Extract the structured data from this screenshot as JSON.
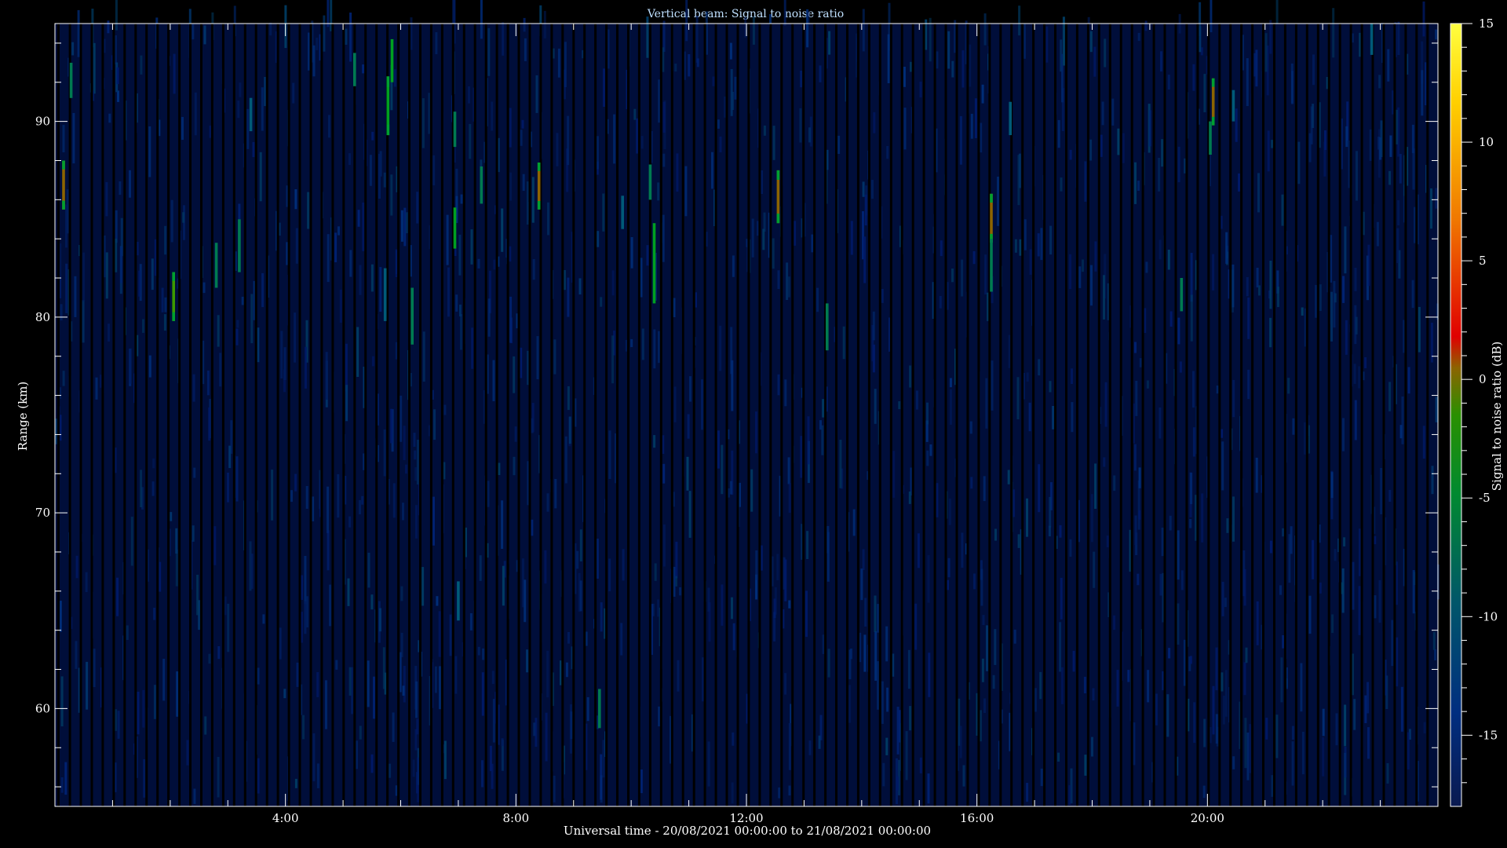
{
  "chart_data": {
    "type": "heatmap",
    "title": "Vertical beam: Signal to noise ratio",
    "xlabel": "Universal time - 20/08/2021 00:00:00 to 21/08/2021 00:00:00",
    "ylabel": "Range (km)",
    "colorbar_label": "Signal to noise ratio (dB)",
    "x_range_hours": [
      0,
      24
    ],
    "y_range_km": [
      55,
      95
    ],
    "color_range_db": [
      -18,
      15
    ],
    "x_ticks": [
      {
        "value": 4,
        "label": "4:00"
      },
      {
        "value": 8,
        "label": "8:00"
      },
      {
        "value": 12,
        "label": "12:00"
      },
      {
        "value": 16,
        "label": "16:00"
      },
      {
        "value": 20,
        "label": "20:00"
      }
    ],
    "y_ticks": [
      {
        "value": 60,
        "label": "60"
      },
      {
        "value": 70,
        "label": "70"
      },
      {
        "value": 80,
        "label": "80"
      },
      {
        "value": 90,
        "label": "90"
      }
    ],
    "cbar_ticks": [
      {
        "value": 15,
        "label": "15"
      },
      {
        "value": 10,
        "label": "10"
      },
      {
        "value": 5,
        "label": "5"
      },
      {
        "value": 0,
        "label": "0"
      },
      {
        "value": -5,
        "label": "-5"
      },
      {
        "value": -10,
        "label": "-10"
      },
      {
        "value": -15,
        "label": "-15"
      }
    ],
    "background_db": -15,
    "data_gap_hours": [
      0.06,
      0.26,
      0.45,
      0.64,
      0.83,
      1.02,
      1.21,
      1.4,
      1.59,
      1.78,
      1.97,
      2.16,
      2.35,
      2.54,
      2.73,
      2.92,
      3.11,
      3.3,
      3.49,
      3.68,
      3.87,
      4.06,
      4.25,
      4.44,
      4.63,
      4.82,
      5.01,
      5.2,
      5.39,
      5.58,
      5.77,
      5.96,
      6.15,
      6.34,
      6.53,
      6.72,
      6.91,
      7.1,
      7.29,
      7.48,
      7.67,
      7.86,
      8.05,
      8.24,
      8.43,
      8.62,
      8.81,
      9.0,
      9.19,
      9.38,
      9.57,
      9.76,
      9.95,
      10.14,
      10.33,
      10.52,
      10.71,
      10.9,
      11.09,
      11.28,
      11.47,
      11.66,
      11.85,
      12.04,
      12.23,
      12.42,
      12.61,
      12.8,
      12.99,
      13.18,
      13.37,
      13.56,
      13.75,
      13.94,
      14.13,
      14.32,
      14.51,
      14.7,
      14.89,
      15.08,
      15.27,
      15.46,
      15.65,
      15.84,
      16.03,
      16.22,
      16.41,
      16.6,
      16.79,
      16.98,
      17.17,
      17.36,
      17.55,
      17.74,
      17.93,
      18.12,
      18.31,
      18.5,
      18.69,
      18.88,
      19.07,
      19.26,
      19.45,
      19.64,
      19.83,
      20.02,
      20.21,
      20.4,
      20.59,
      20.78,
      20.97,
      21.16,
      21.35,
      21.54,
      21.73,
      21.92,
      22.11,
      22.3,
      22.49,
      22.68,
      22.87,
      23.06,
      23.25,
      23.44,
      23.63,
      23.82
    ],
    "echoes": [
      {
        "t": 0.15,
        "r0": 85.5,
        "r1": 88,
        "db": 0
      },
      {
        "t": 0.28,
        "r0": 91.2,
        "r1": 93,
        "db": -7
      },
      {
        "t": 2.06,
        "r0": 79.8,
        "r1": 82.3,
        "db": -2
      },
      {
        "t": 2.8,
        "r0": 81.5,
        "r1": 83.8,
        "db": -6
      },
      {
        "t": 3.2,
        "r0": 82.3,
        "r1": 85,
        "db": -8
      },
      {
        "t": 3.4,
        "r0": 89.5,
        "r1": 91.2,
        "db": -9
      },
      {
        "t": 5.2,
        "r0": 91.8,
        "r1": 93.5,
        "db": -8
      },
      {
        "t": 5.73,
        "r0": 79.8,
        "r1": 82.5,
        "db": -9
      },
      {
        "t": 5.78,
        "r0": 89.3,
        "r1": 92.3,
        "db": -3
      },
      {
        "t": 5.85,
        "r0": 92,
        "r1": 94.2,
        "db": -4
      },
      {
        "t": 6.2,
        "r0": 78.6,
        "r1": 81.5,
        "db": -8
      },
      {
        "t": 6.94,
        "r0": 88.7,
        "r1": 90.5,
        "db": -7
      },
      {
        "t": 6.94,
        "r0": 83.5,
        "r1": 85.6,
        "db": -5
      },
      {
        "t": 7.0,
        "r0": 64.5,
        "r1": 66.5,
        "db": -9
      },
      {
        "t": 7.4,
        "r0": 85.8,
        "r1": 87.7,
        "db": -8
      },
      {
        "t": 8.4,
        "r0": 85.5,
        "r1": 87.9,
        "db": 0
      },
      {
        "t": 9.45,
        "r0": 59,
        "r1": 61,
        "db": -7
      },
      {
        "t": 9.85,
        "r0": 84.5,
        "r1": 86.2,
        "db": -9
      },
      {
        "t": 10.33,
        "r0": 86,
        "r1": 87.8,
        "db": -6
      },
      {
        "t": 10.4,
        "r0": 80.7,
        "r1": 84.8,
        "db": -5
      },
      {
        "t": 12.55,
        "r0": 84.8,
        "r1": 87.5,
        "db": 0
      },
      {
        "t": 13.4,
        "r0": 78.3,
        "r1": 80.7,
        "db": -6
      },
      {
        "t": 16.25,
        "r0": 83.8,
        "r1": 86.3,
        "db": 0
      },
      {
        "t": 16.25,
        "r0": 81.3,
        "r1": 84,
        "db": -7
      },
      {
        "t": 16.58,
        "r0": 89.3,
        "r1": 91,
        "db": -9
      },
      {
        "t": 19.55,
        "r0": 80.3,
        "r1": 82,
        "db": -8
      },
      {
        "t": 20.1,
        "r0": 89.8,
        "r1": 92.2,
        "db": 0
      },
      {
        "t": 20.05,
        "r0": 88.3,
        "r1": 90,
        "db": -7
      },
      {
        "t": 20.45,
        "r0": 90,
        "r1": 91.6,
        "db": -9
      },
      {
        "t": 22.85,
        "r0": 93.4,
        "r1": 95,
        "db": -9
      }
    ],
    "colorscale": [
      "#00003a",
      "#001a6e",
      "#003a8c",
      "#005a78",
      "#007a50",
      "#00a020",
      "#3c9a00",
      "#8c6400",
      "#d40000",
      "#e84a00",
      "#f59a00",
      "#ffe000",
      "#ffff30"
    ]
  }
}
